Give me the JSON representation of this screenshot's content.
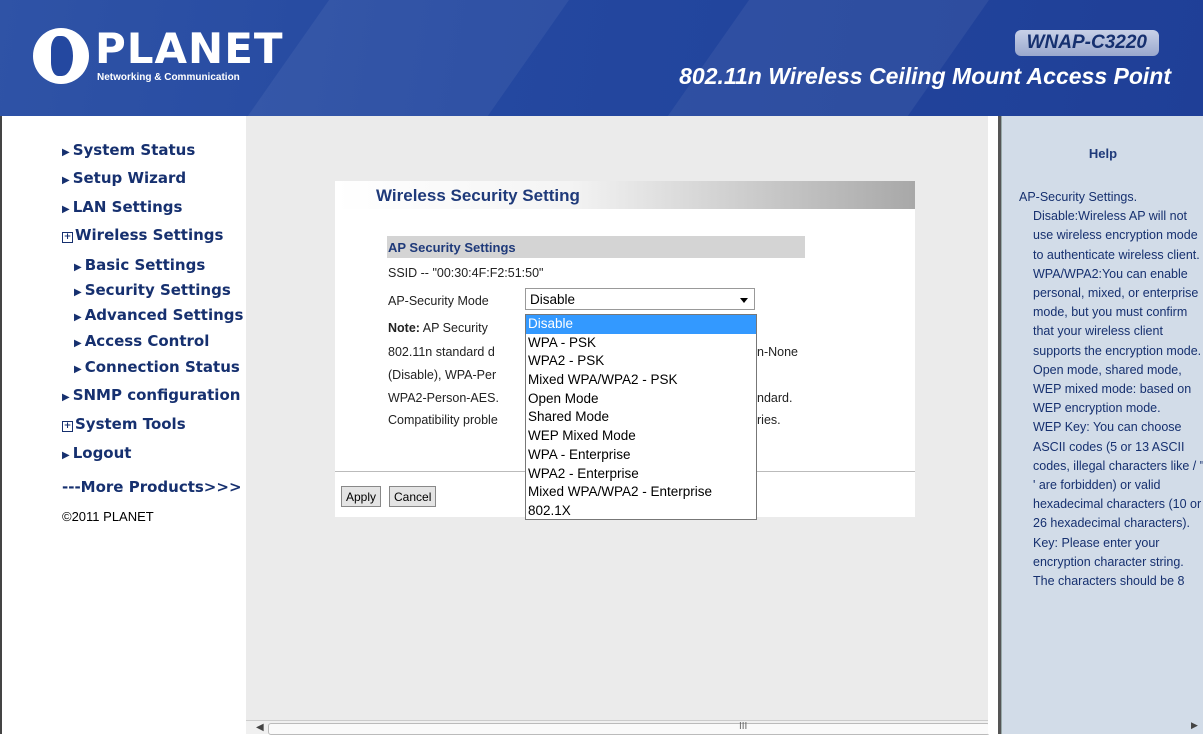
{
  "brand": {
    "logo": "PLANET",
    "tagline": "Networking & Communication"
  },
  "header": {
    "model": "WNAP-C3220",
    "product_title": "802.11n Wireless Ceiling Mount Access Point"
  },
  "menu": [
    {
      "label": "System Status",
      "type": "link"
    },
    {
      "label": "Setup Wizard",
      "type": "link"
    },
    {
      "label": "LAN Settings",
      "type": "link"
    },
    {
      "label": "Wireless Settings",
      "type": "group"
    },
    {
      "label": "Basic Settings",
      "type": "sub"
    },
    {
      "label": "Security Settings",
      "type": "sub"
    },
    {
      "label": "Advanced Settings",
      "type": "sub"
    },
    {
      "label": "Access Control",
      "type": "sub"
    },
    {
      "label": "Connection Status",
      "type": "sub"
    },
    {
      "label": "SNMP configuration",
      "type": "link"
    },
    {
      "label": "System Tools",
      "type": "group"
    },
    {
      "label": "Logout",
      "type": "link"
    },
    {
      "label": "---More Products>>>",
      "type": "more"
    }
  ],
  "copyright": "©2011 PLANET",
  "main": {
    "section_title": "Wireless Security Setting",
    "ap_section": "AP Security Settings",
    "ssid": "SSID -- \"00:30:4F:F2:51:50\"",
    "mode_label": "AP-Security Mode",
    "mode_value": "Disable",
    "note_label": "Note:",
    "note_lines": [
      "AP Security",
      "802.11n standard d",
      "(Disable), WPA-Per",
      "WPA2-Person-AES.",
      "Compatibility proble"
    ],
    "note_right": [
      "n-None",
      "ndard.",
      "ries."
    ],
    "options": [
      "Disable",
      "WPA - PSK",
      "WPA2 - PSK",
      "Mixed WPA/WPA2 - PSK",
      "Open Mode",
      "Shared Mode",
      "WEP Mixed Mode",
      "WPA - Enterprise",
      "WPA2 - Enterprise",
      "Mixed WPA/WPA2 - Enterprise",
      "802.1X"
    ],
    "apply_label": "Apply",
    "cancel_label": "Cancel"
  },
  "help": {
    "title": "Help",
    "paragraphs": [
      "AP-Security Settings.",
      "Disable:Wireless AP will not use wireless encryption mode to authenticate wireless client.",
      "WPA/WPA2:You can enable personal, mixed, or enterprise mode, but you must confirm that your wireless client supports the encryption mode.",
      "Open mode, shared mode, WEP mixed mode: based on WEP encryption mode.",
      "WEP Key: You can choose ASCII codes (5 or 13 ASCII codes, illegal characters like / \" ' are forbidden) or valid hexadecimal characters (10 or 26 hexadecimal characters).",
      "Key: Please enter your encryption character string. The characters should be 8"
    ]
  },
  "scrollbar": {
    "grip": "III"
  },
  "colors": {
    "header_bg": "#2448a0",
    "menu_text": "#16306f",
    "help_bg": "#d2dce8",
    "selected_option": "#3399ff"
  }
}
